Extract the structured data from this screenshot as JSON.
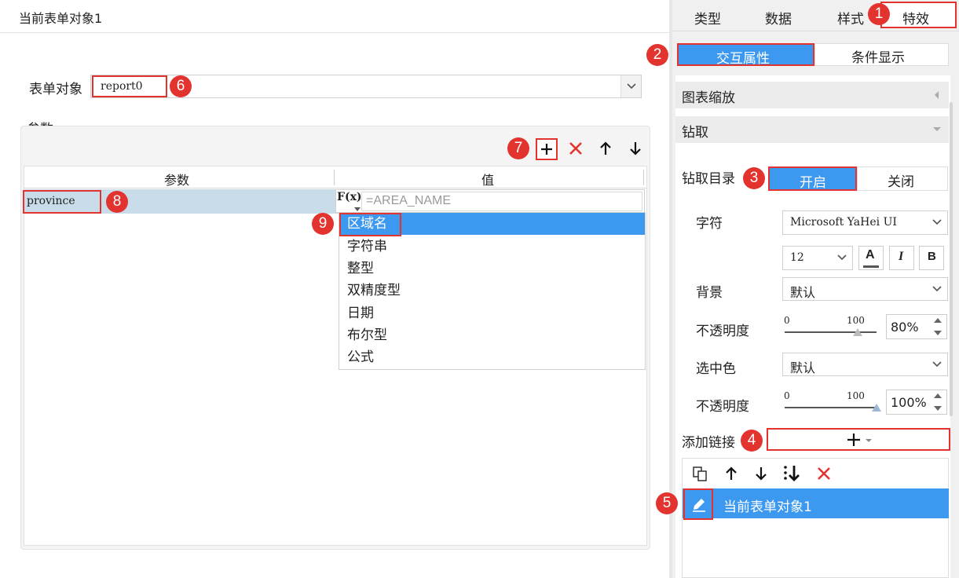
{
  "left_panel": {
    "title": "当前表单对象1",
    "form_object_label": "表单对象",
    "form_object_value": "report0",
    "params_group_label": "参数",
    "table_header_param": "参数",
    "table_header_value": "值",
    "param_name": "province",
    "formula_value": "=AREA_NAME",
    "formula_icon_text": "F(x)",
    "dropdown_items": [
      "区域名",
      "字符串",
      "整型",
      "双精度型",
      "日期",
      "布尔型",
      "公式"
    ],
    "dropdown_selected_index": 0
  },
  "right_panel": {
    "tabs": [
      "类型",
      "数据",
      "样式",
      "特效"
    ],
    "active_tab": "特效",
    "subtabs": [
      "交互属性",
      "条件显示"
    ],
    "active_subtab": "交互属性",
    "section_zoom": "图表缩放",
    "section_drill": "钻取",
    "drill_dir_label": "钻取目录",
    "drill_on": "开启",
    "drill_off": "关闭",
    "font_label": "字符",
    "font_value": "Microsoft YaHei UI",
    "font_size": "12",
    "bg_label": "背景",
    "bg_value": "默认",
    "opacity_label": "不透明度",
    "opacity1_value": "80%",
    "opacity1_fraction": 0.8,
    "slider_min": "0",
    "slider_max": "100",
    "selected_color_label": "选中色",
    "selected_color_value": "默认",
    "opacity2_value": "100%",
    "opacity2_fraction": 1.0,
    "add_link_label": "添加链接",
    "link_item_label": "当前表单对象1"
  },
  "badges": [
    "1",
    "2",
    "3",
    "4",
    "5",
    "6",
    "7",
    "8",
    "9"
  ],
  "colors": {
    "accent_blue": "#3d98f0",
    "selection_blue": "#c9dcea",
    "badge_red": "#e2332f",
    "panel_gray": "#f0f0f0",
    "section_gray": "#ebebeb"
  }
}
